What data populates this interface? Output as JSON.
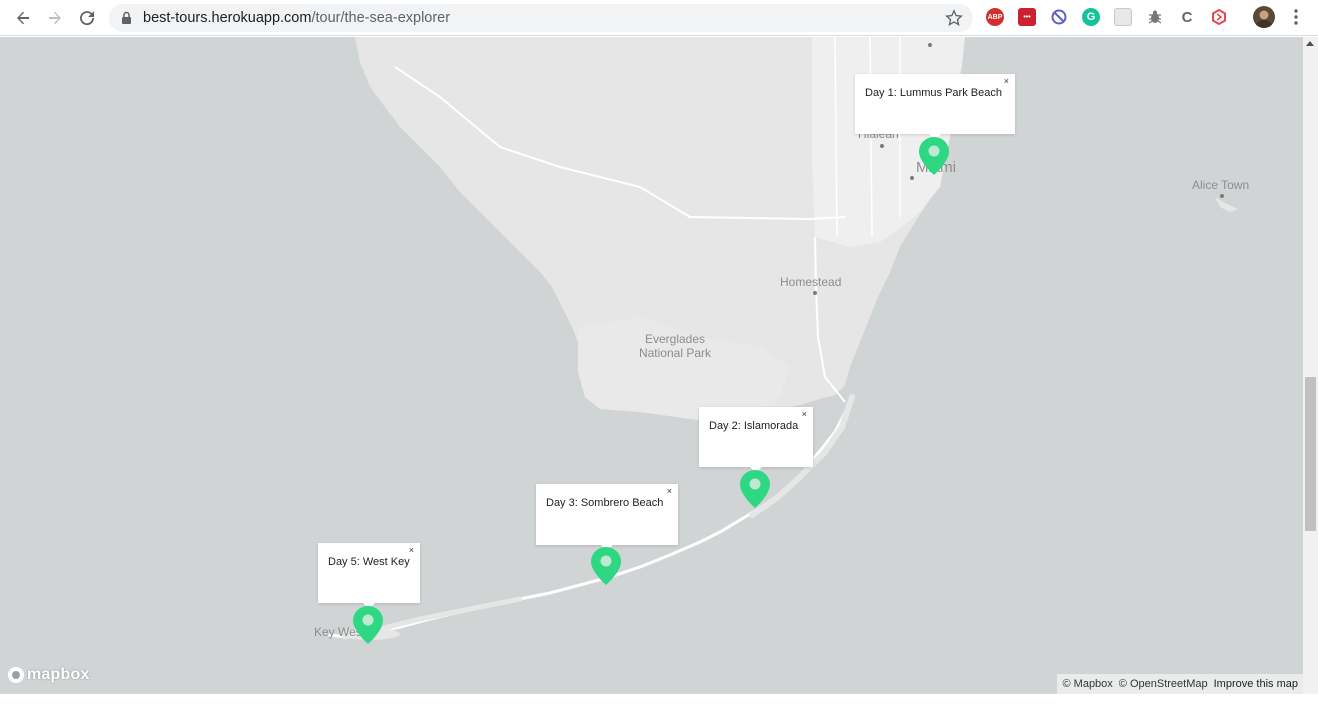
{
  "browser": {
    "url_host": "best-tours.herokuapp.com",
    "url_path": "/tour/the-sea-explorer",
    "icons": [
      "back-icon",
      "forward-icon",
      "reload-icon",
      "lock-icon",
      "bookmark-star-icon",
      "menu-dots-icon"
    ],
    "extensions": [
      {
        "name": "adblock-icon",
        "label": "ABP",
        "color": "#d32f2f"
      },
      {
        "name": "lastpass-icon",
        "label": "•••",
        "color": "#cc2131"
      },
      {
        "name": "blocker-icon",
        "label": "",
        "color": "#5c5fc4"
      },
      {
        "name": "grammarly-icon",
        "label": "G",
        "color": "#15c39a"
      },
      {
        "name": "extension-icon",
        "label": "",
        "color": "#c8c8c8"
      },
      {
        "name": "bug-icon",
        "label": "",
        "color": "#777777"
      },
      {
        "name": "code-icon",
        "label": "C",
        "color": "#666666"
      },
      {
        "name": "hexagon-icon",
        "label": "",
        "color": "#e5484d"
      }
    ]
  },
  "map": {
    "places": {
      "alice_town": "Alice Town",
      "homestead": "Homestead",
      "everglades_line1": "Everglades",
      "everglades_line2": "National Park",
      "hialeah": "Hialeah",
      "miami": "Miami",
      "key_west": "Key West"
    },
    "popups": [
      {
        "label": "Day 1: Lummus Park Beach",
        "close": "×"
      },
      {
        "label": "Day 2: Islamorada",
        "close": "×"
      },
      {
        "label": "Day 3: Sombrero Beach",
        "close": "×"
      },
      {
        "label": "Day 5: West Key",
        "close": "×"
      }
    ],
    "marker_color": "#2ed882",
    "land_color": "#e6e6e6",
    "water_color": "#d1d4d5",
    "logo_text": "mapbox",
    "attribution": {
      "mapbox": "© Mapbox",
      "osm": "© OpenStreetMap",
      "improve": "Improve this map"
    }
  }
}
